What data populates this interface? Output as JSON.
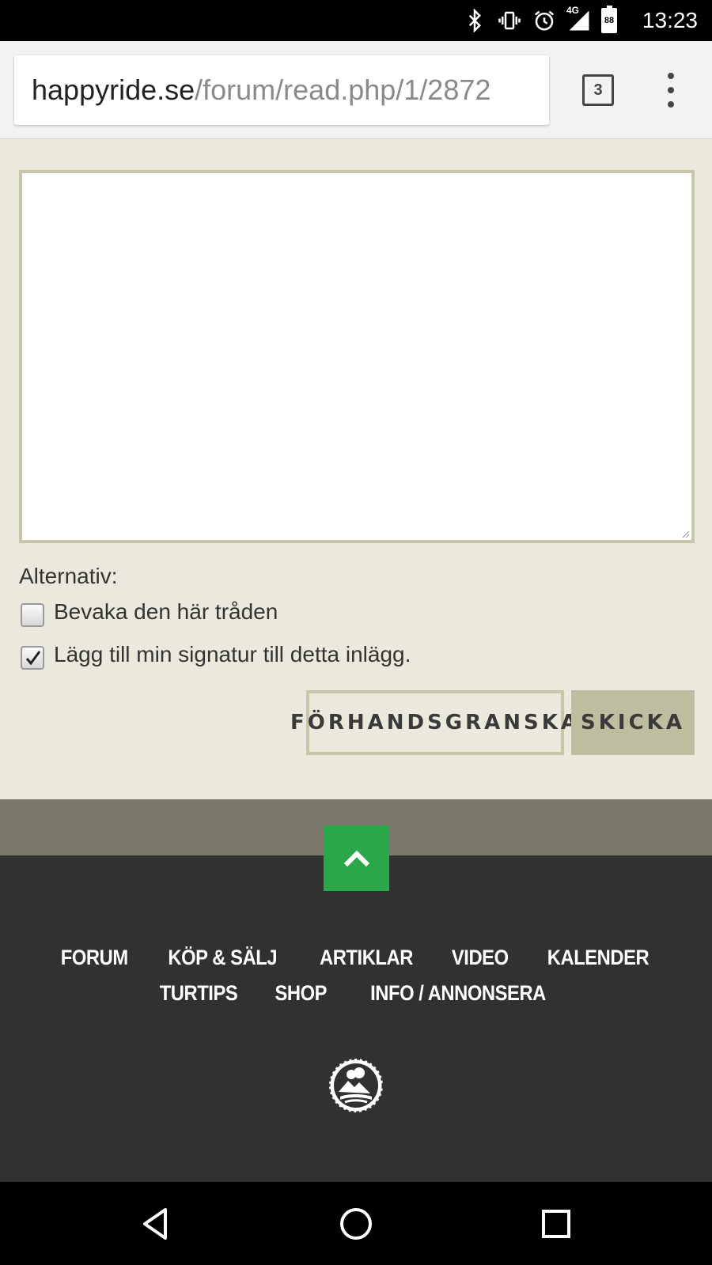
{
  "status_bar": {
    "time": "13:23",
    "network": "4G",
    "battery": "88",
    "icons": [
      "bluetooth-icon",
      "vibrate-icon",
      "alarm-icon",
      "signal-icon",
      "battery-icon"
    ]
  },
  "browser": {
    "url_host": "happyride.se",
    "url_path": "/forum/read.php/1/2872",
    "tab_count": "3"
  },
  "form": {
    "options_label": "Alternativ:",
    "options": [
      {
        "label": "Bevaka den här tråden",
        "checked": false
      },
      {
        "label": "Lägg till min signatur till detta inlägg.",
        "checked": true
      }
    ],
    "preview_button": "FÖRHANDSGRANSKA",
    "send_button": "SKICKA"
  },
  "footer": {
    "nav": [
      "FORUM",
      "KÖP & SÄLJ",
      "ARTIKLAR",
      "VIDEO",
      "KALENDER",
      "TURTIPS",
      "SHOP",
      "INFO / ANNONSERA"
    ]
  },
  "colors": {
    "page_bg": "#ebe9dd",
    "border_accent": "#c8c6a8",
    "send_bg": "#bfbd9f",
    "footer_band": "#7d786e",
    "footer_bg": "#313131",
    "to_top_green": "#2aa84a"
  }
}
